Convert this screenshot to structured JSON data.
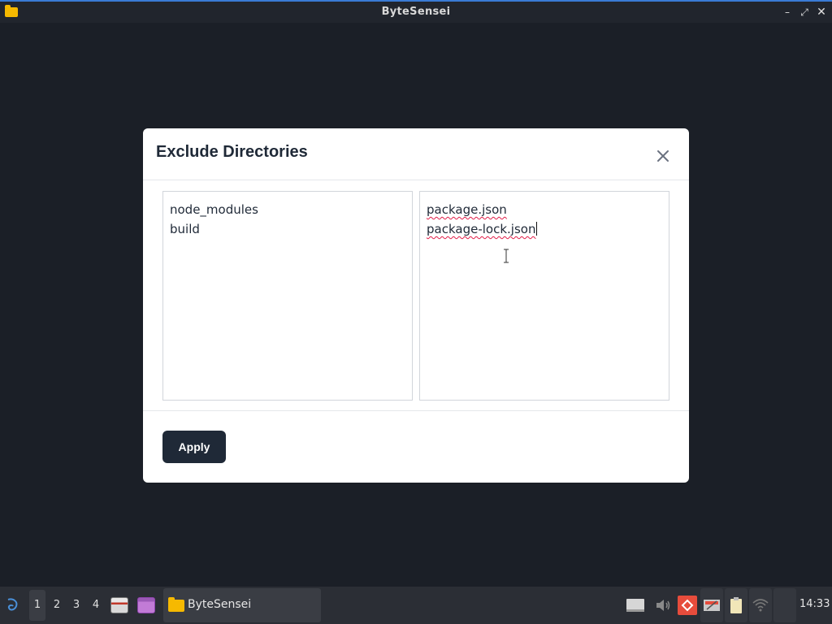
{
  "window": {
    "title": "ByteSensei"
  },
  "dialog": {
    "title": "Exclude Directories",
    "left_panel": {
      "lines": [
        "node_modules",
        "build"
      ]
    },
    "right_panel": {
      "lines": [
        "package.json",
        "package-lock.json"
      ]
    },
    "apply_label": "Apply"
  },
  "taskbar": {
    "workspaces": [
      "1",
      "2",
      "3",
      "4"
    ],
    "active_workspace": "1",
    "task_label": "ByteSensei",
    "clock": "14:33"
  },
  "colors": {
    "background": "#1b1f27",
    "accent": "#3a7bd5",
    "apply_button": "#1f2937",
    "folder": "#f6b900"
  },
  "icons": [
    "folder-icon",
    "minimize-icon",
    "maximize-icon",
    "close-icon",
    "start-menu-icon",
    "file-manager-icon",
    "app-launcher-icon",
    "drive-icon",
    "volume-icon",
    "anydesk-icon",
    "screenshot-icon",
    "clipboard-icon",
    "wifi-icon"
  ]
}
